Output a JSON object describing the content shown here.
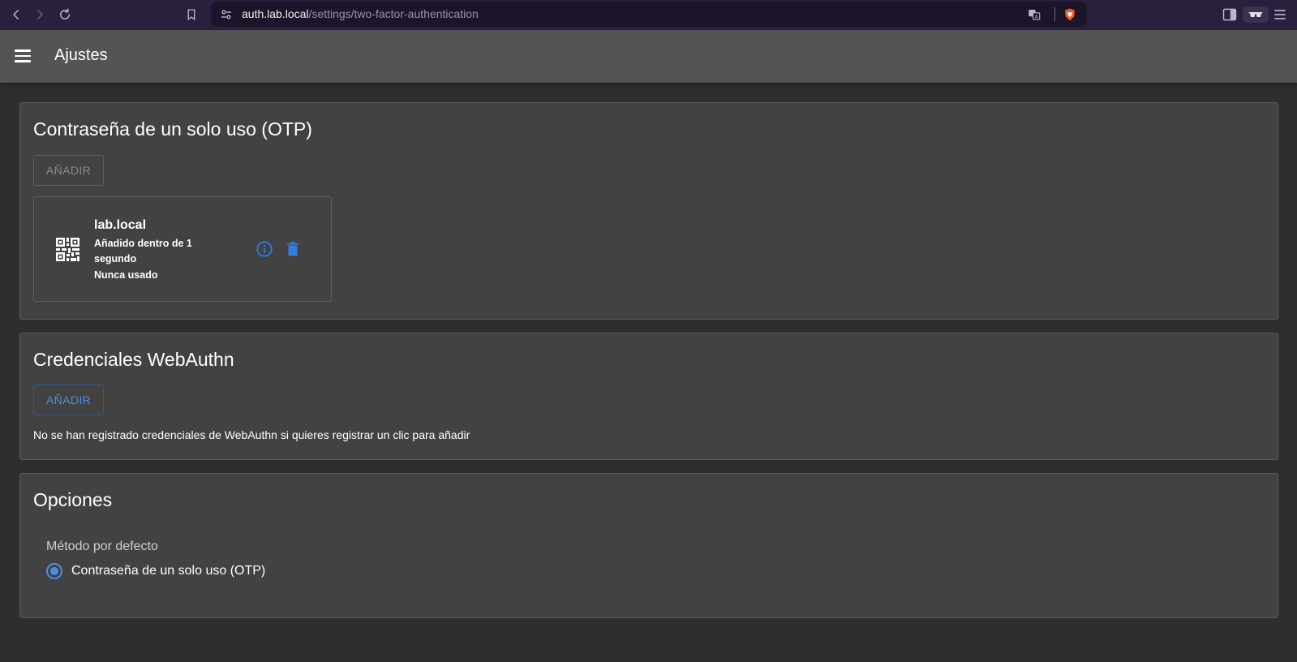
{
  "browser": {
    "url_host": "auth.lab.local",
    "url_path": "/settings/two-factor-authentication",
    "icons": [
      "back-icon",
      "forward-icon",
      "reload-icon",
      "bookmark-icon",
      "site-settings-icon",
      "translate-icon",
      "brave-shield-icon",
      "sidebar-icon",
      "private-glasses-icon",
      "browser-menu-icon"
    ]
  },
  "appbar": {
    "title": "Ajustes",
    "menu_icon": "hamburger-menu-icon"
  },
  "otp": {
    "title": "Contraseña de un solo uso (OTP)",
    "add_label": "AÑADIR",
    "card": {
      "name": "lab.local",
      "added_line1": "Añadido dentro de 1",
      "added_line2": "segundo",
      "usage": "Nunca usado",
      "icon": "qr-code-icon",
      "info_icon": "info-icon",
      "delete_icon": "trash-icon"
    }
  },
  "webauthn": {
    "title": "Credenciales WebAuthn",
    "add_label": "AÑADIR",
    "empty_message": "No se han registrado credenciales de WebAuthn si quieres registrar un clic para añadir"
  },
  "options": {
    "title": "Opciones",
    "default_method_label": "Método por defecto",
    "methods": [
      {
        "label": "Contraseña de un solo uso (OTP)",
        "selected": true
      }
    ]
  },
  "colors": {
    "browser_bar": "#2a1f3d",
    "appbar": "#545454",
    "background": "#2e2e2e",
    "panel": "#424242",
    "primary": "#4a90e2"
  }
}
